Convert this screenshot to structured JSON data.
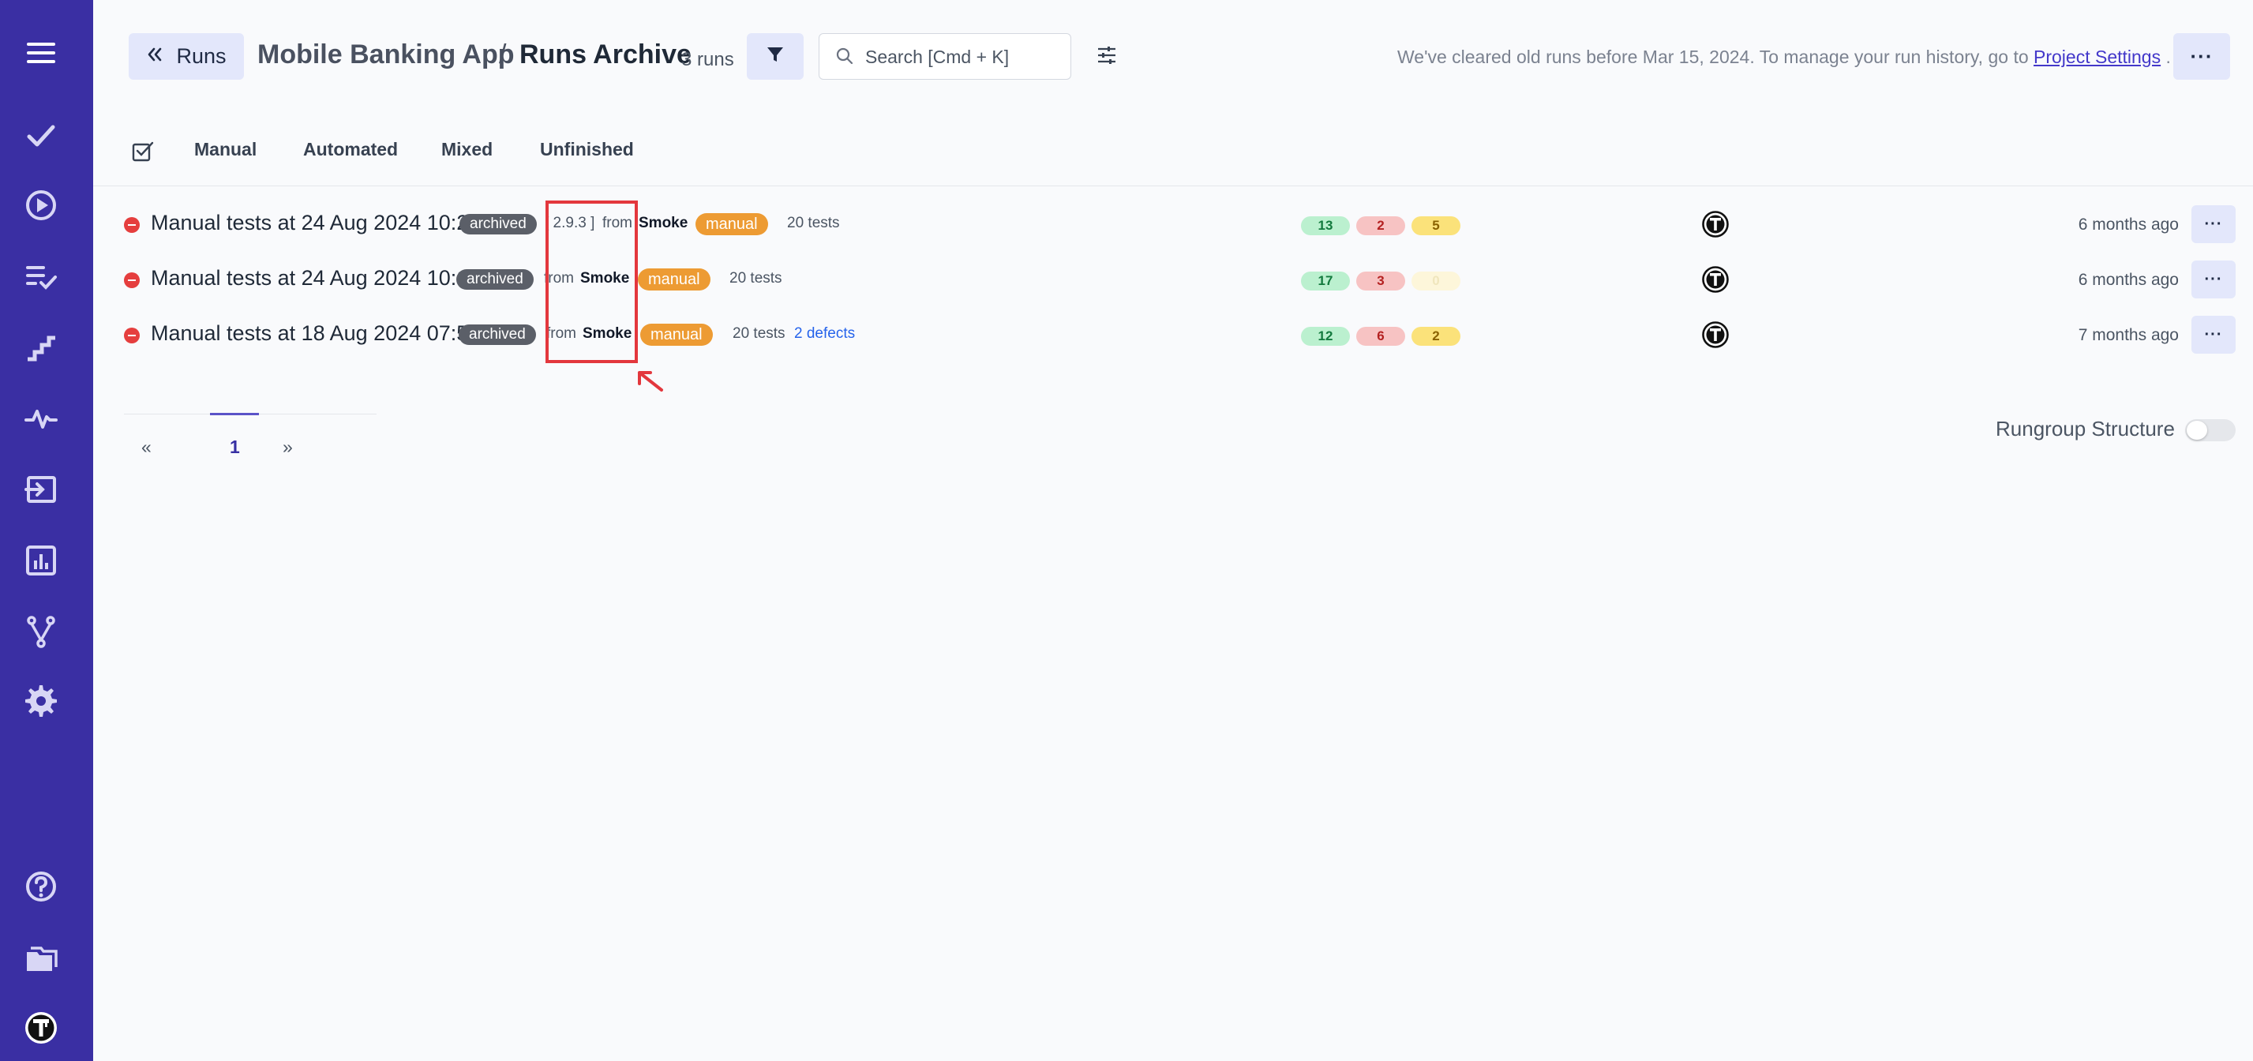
{
  "sidebar": {
    "items": [
      {
        "name": "menu-icon"
      },
      {
        "name": "check-icon"
      },
      {
        "name": "play-circle-icon"
      },
      {
        "name": "list-check-icon"
      },
      {
        "name": "stairs-icon"
      },
      {
        "name": "pulse-icon"
      },
      {
        "name": "import-icon"
      },
      {
        "name": "bar-chart-icon"
      },
      {
        "name": "branch-icon"
      },
      {
        "name": "gear-icon"
      },
      {
        "name": "help-icon"
      },
      {
        "name": "folders-icon"
      },
      {
        "name": "testomat-logo-icon"
      }
    ],
    "bg_color": "#3a2fa3"
  },
  "header": {
    "back_label": "Runs",
    "project": "Mobile Banking App",
    "separator": "/",
    "title": "Runs Archive",
    "runs_count": "3 runs",
    "search_placeholder": "Search [Cmd + K]",
    "notice_text": "We've cleared old runs before Mar 15, 2024. To manage your run history, go to",
    "notice_link": "Project Settings",
    "notice_end": ".",
    "more_label": "···"
  },
  "tabs": [
    "Manual",
    "Automated",
    "Mixed",
    "Unfinished"
  ],
  "runs": [
    {
      "title": "Manual tests at 24 Aug 2024 10:25",
      "archived": "archived",
      "version": "[ 2.9.3 ]",
      "from": "from",
      "suite": "Smoke",
      "type": "manual",
      "tests": "20 tests",
      "defects": "",
      "passed": "13",
      "failed": "2",
      "skipped": "5",
      "ago": "6 months ago"
    },
    {
      "title": "Manual tests at 24 Aug 2024 10:17",
      "archived": "archived",
      "version": "",
      "from": "from",
      "suite": "Smoke",
      "type": "manual",
      "tests": "20 tests",
      "defects": "",
      "passed": "17",
      "failed": "3",
      "skipped": "0",
      "ago": "6 months ago"
    },
    {
      "title": "Manual tests at 18 Aug 2024 07:53",
      "archived": "archived",
      "version": "",
      "from": "from",
      "suite": "Smoke",
      "type": "manual",
      "tests": "20 tests",
      "defects": "2 defects",
      "passed": "12",
      "failed": "6",
      "skipped": "2",
      "ago": "7 months ago"
    }
  ],
  "row_more_label": "···",
  "pagination": {
    "prev": "«",
    "current": "1",
    "next": "»"
  },
  "rungroup": {
    "label": "Rungroup Structure",
    "enabled": false
  },
  "colors": {
    "accent": "#3a2fa3",
    "highlight": "#e3373d",
    "manual_badge": "#ed9b33",
    "archived_badge": "#5b5f68"
  }
}
